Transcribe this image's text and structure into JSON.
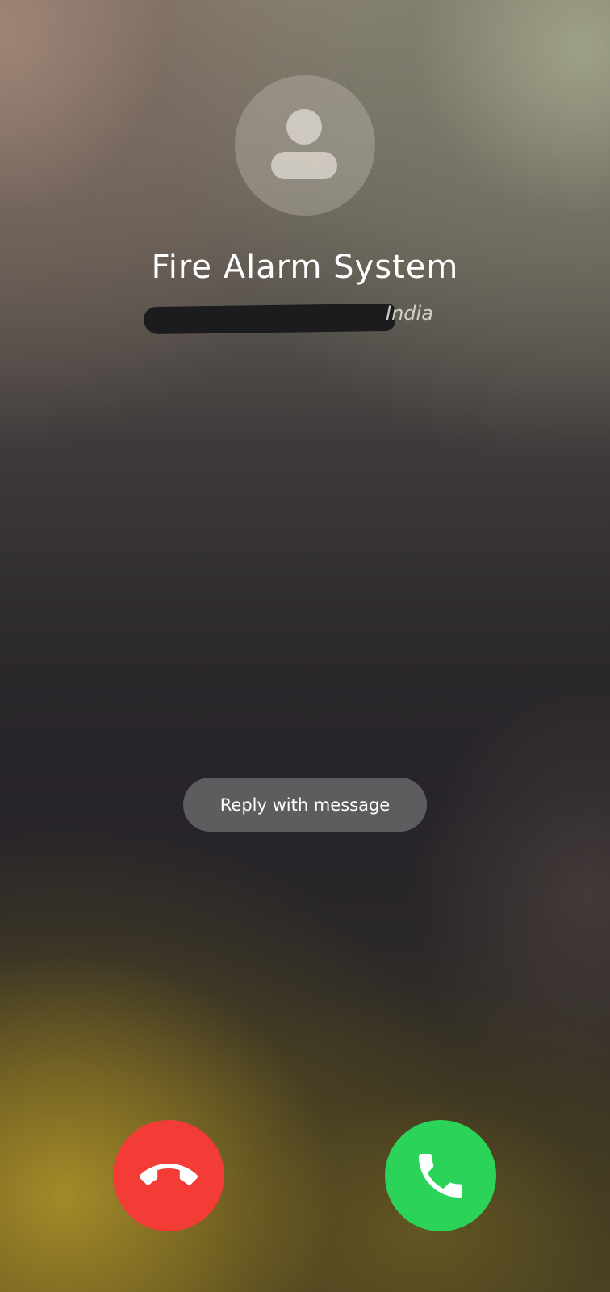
{
  "caller": {
    "name": "Fire Alarm System",
    "location": "India",
    "number_redacted": true
  },
  "actions": {
    "reply_label": "Reply with message",
    "decline_icon": "phone-hangup-icon",
    "accept_icon": "phone-icon"
  },
  "colors": {
    "decline": "#f23c35",
    "accept": "#2bd458",
    "reply_bg": "#6e6c6e"
  }
}
